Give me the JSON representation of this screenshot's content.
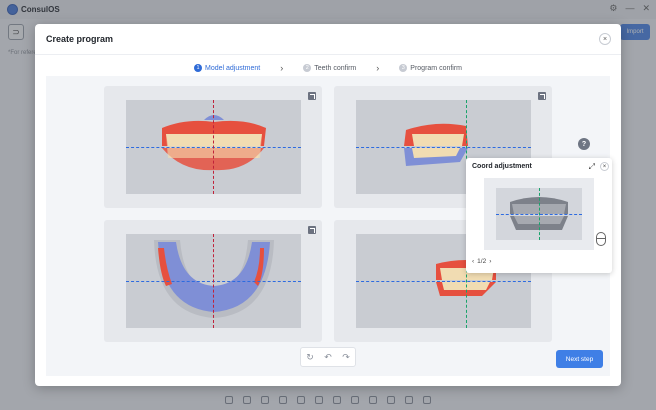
{
  "app": {
    "name": "ConsulOS",
    "import_label": "Import",
    "note": "*For reference only"
  },
  "modal": {
    "title": "Create program",
    "close_symbol": "×"
  },
  "steps": [
    {
      "num": "1",
      "label": "Model adjustment",
      "active": true
    },
    {
      "num": "2",
      "label": "Teeth confirm",
      "active": false
    },
    {
      "num": "3",
      "label": "Program confirm",
      "active": false
    }
  ],
  "step_separator": "›",
  "coord_panel": {
    "title": "Coord adjustment",
    "page": "1/2",
    "prev": "‹",
    "next": "›",
    "fullscreen_symbol": "⤢",
    "close_symbol": "×"
  },
  "history": {
    "reset": "↻",
    "undo": "↶",
    "redo": "↷"
  },
  "help_symbol": "?",
  "next_button": "Next step",
  "colors": {
    "accent": "#2f6bd7",
    "primary_button": "#3f7fe6",
    "axis_horizontal": "#2d6be0",
    "axis_vertical_red": "#c0223a",
    "axis_vertical_green": "#19a36b",
    "gum": "#e6503f",
    "tooth": "#f1dcb2",
    "model": "#7f8fd6"
  }
}
